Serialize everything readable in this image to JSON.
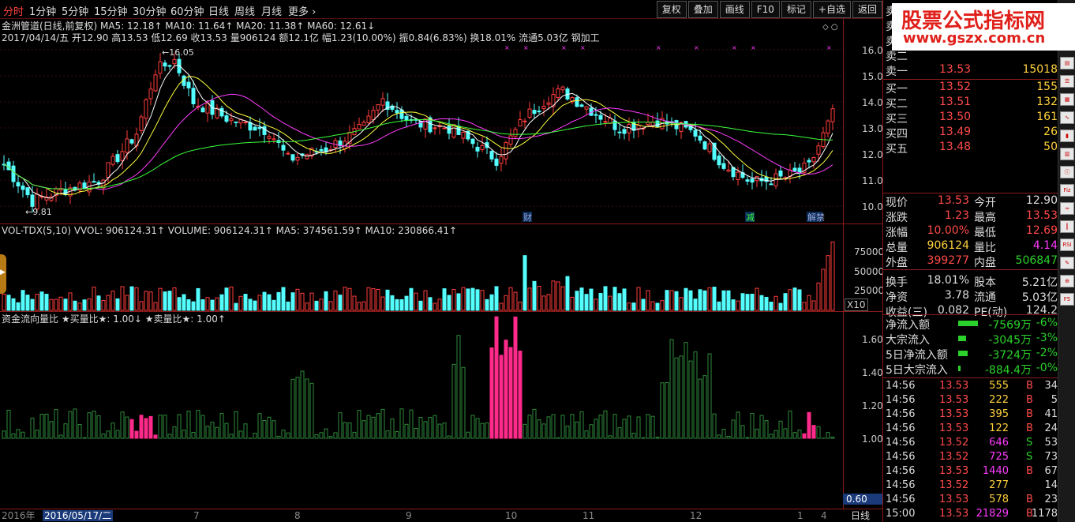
{
  "periods": [
    "分时",
    "1分钟",
    "5分钟",
    "15分钟",
    "30分钟",
    "60分钟",
    "日线",
    "周线",
    "月线",
    "更多"
  ],
  "toolbar": [
    "复权",
    "叠加",
    "画线",
    "F10",
    "标记",
    "+自选",
    "返回"
  ],
  "chart_info": {
    "ma_line": "金洲管道(日线,前复权) MA5: 12.18↑  MA10: 11.64↑  MA20: 11.38↑  MA60: 12.61↓",
    "quote_line": "2017/04/14/五 开12.90 高13.53 低12.69 收13.53 量906124 额12.1亿 幅1.23(10.00%) 振0.84(6.83%) 换18.01% 流通5.03亿 钢加工",
    "high_mark": "16.05",
    "low_mark": "9.81",
    "price_axis": [
      "16.00",
      "15.00",
      "14.00",
      "13.00",
      "12.00",
      "11.00",
      "10.00"
    ],
    "events": [
      "财",
      "减",
      "解禁"
    ]
  },
  "volume_panel": {
    "label": "VOL-TDX(5,10) VVOL: 906124.31↑   VOLUME: 906124.31↑   MA5: 374561.59↑   MA10: 230866.41↑",
    "axis": [
      "75000",
      "50000",
      "25000"
    ],
    "unit": "X10"
  },
  "flow_panel": {
    "label": "资金流向量比  ★买量比★: 1.00↓  ★卖量比★: 1.00↑",
    "axis": [
      "1.60",
      "1.40",
      "1.20",
      "1.00"
    ],
    "cursor_value": "0.60"
  },
  "time_axis": {
    "year": "2016年",
    "date": "2016/05/17/二",
    "months": [
      "7",
      "8",
      "9",
      "10",
      "11",
      "12",
      "1",
      "4"
    ],
    "period": "日线"
  },
  "watermark": {
    "title": "股票公式指标网",
    "url": "www.gszx.com.cn"
  },
  "orderbook": [
    {
      "label": "卖五",
      "price": "",
      "vol": ""
    },
    {
      "label": "卖四",
      "price": "",
      "vol": ""
    },
    {
      "label": "卖三",
      "price": "",
      "vol": ""
    },
    {
      "label": "卖二",
      "price": "",
      "vol": ""
    },
    {
      "label": "卖一",
      "price": "13.53",
      "vol": "15018"
    },
    {
      "label": "买一",
      "price": "13.52",
      "vol": "155"
    },
    {
      "label": "买二",
      "price": "13.51",
      "vol": "132"
    },
    {
      "label": "买三",
      "price": "13.50",
      "vol": "161"
    },
    {
      "label": "买四",
      "price": "13.49",
      "vol": "26"
    },
    {
      "label": "买五",
      "price": "13.48",
      "vol": "50"
    }
  ],
  "stats": [
    {
      "k1": "现价",
      "v1": "13.53",
      "k2": "今开",
      "v2": "12.90"
    },
    {
      "k1": "涨跌",
      "v1": "1.23",
      "k2": "最高",
      "v2": "13.53"
    },
    {
      "k1": "涨幅",
      "v1": "10.00%",
      "k2": "最低",
      "v2": "12.69"
    },
    {
      "k1": "总量",
      "v1": "906124",
      "k2": "量比",
      "v2": "4.14"
    },
    {
      "k1": "外盘",
      "v1": "399277",
      "k2": "内盘",
      "v2": "506847"
    },
    {
      "k1": "换手",
      "v1": "18.01%",
      "k2": "股本",
      "v2": "5.21亿"
    },
    {
      "k1": "净资",
      "v1": "3.78",
      "k2": "流通",
      "v2": "5.03亿"
    },
    {
      "k1": "收益(三)",
      "v1": "0.082",
      "k2": "PE(动)",
      "v2": "124.2"
    }
  ],
  "fund_flow": [
    {
      "label": "净流入额",
      "value": "-7569万",
      "pct": "-6%",
      "bar": 0.95
    },
    {
      "label": "大宗流入",
      "value": "-3045万",
      "pct": "-3%",
      "bar": 0.4
    },
    {
      "label": "5日净流入额",
      "value": "-3724万",
      "pct": "-2%",
      "bar": 0.45
    },
    {
      "label": "5日大宗流入",
      "value": "-884.4万",
      "pct": "-0%",
      "bar": 0.1
    }
  ],
  "ticks": [
    {
      "t": "14:56",
      "p": "13.53",
      "v": "555",
      "d": "B",
      "n": "34"
    },
    {
      "t": "14:56",
      "p": "13.53",
      "v": "222",
      "d": "B",
      "n": "5"
    },
    {
      "t": "14:56",
      "p": "13.53",
      "v": "395",
      "d": "B",
      "n": "41"
    },
    {
      "t": "14:56",
      "p": "13.53",
      "v": "122",
      "d": "B",
      "n": "24"
    },
    {
      "t": "14:56",
      "p": "13.52",
      "v": "646",
      "d": "S",
      "n": "53"
    },
    {
      "t": "14:56",
      "p": "13.52",
      "v": "725",
      "d": "S",
      "n": "73"
    },
    {
      "t": "14:56",
      "p": "13.53",
      "v": "1440",
      "d": "B",
      "n": "67"
    },
    {
      "t": "14:56",
      "p": "13.52",
      "v": "277",
      "d": "",
      "n": "14"
    },
    {
      "t": "14:56",
      "p": "13.53",
      "v": "578",
      "d": "B",
      "n": "23"
    },
    {
      "t": "15:00",
      "p": "13.53",
      "v": "21829",
      "d": "B",
      "n": "1178"
    }
  ],
  "side_icons": [
    "chart-icon",
    "list-icon",
    "grid-icon",
    "line-icon",
    "bar-icon",
    "table-icon",
    "info-icon",
    "fiz-icon",
    "dna-icon",
    "candle-icon",
    "rsi-icon",
    "tool-icon",
    "zoom-icon",
    "f5-icon"
  ]
}
